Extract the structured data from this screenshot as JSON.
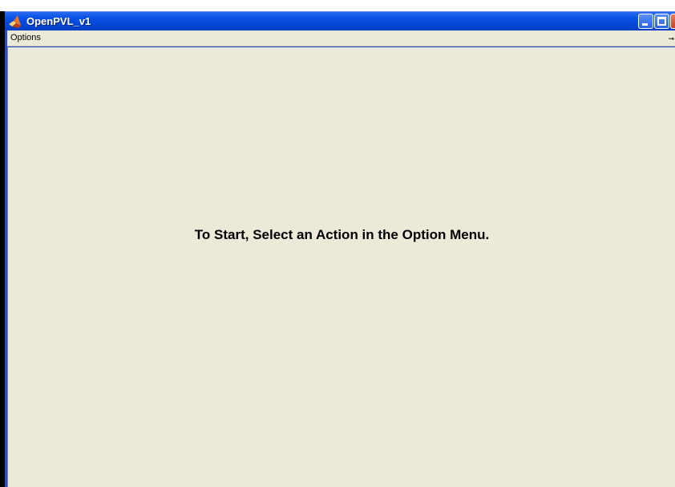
{
  "window": {
    "title": "OpenPVL_v1",
    "controls": [
      "minimize",
      "maximize",
      "close"
    ]
  },
  "menubar": {
    "items": [
      {
        "label": "Options"
      }
    ]
  },
  "main": {
    "message": "To Start, Select an Action in the Option Menu."
  },
  "colors": {
    "titlebar": "#0a52e6",
    "client_background": "#ece9d8",
    "close_button": "#c8431f"
  },
  "icons": {
    "app": "matlab-logo-icon",
    "dock": "dock-arrow-icon"
  }
}
